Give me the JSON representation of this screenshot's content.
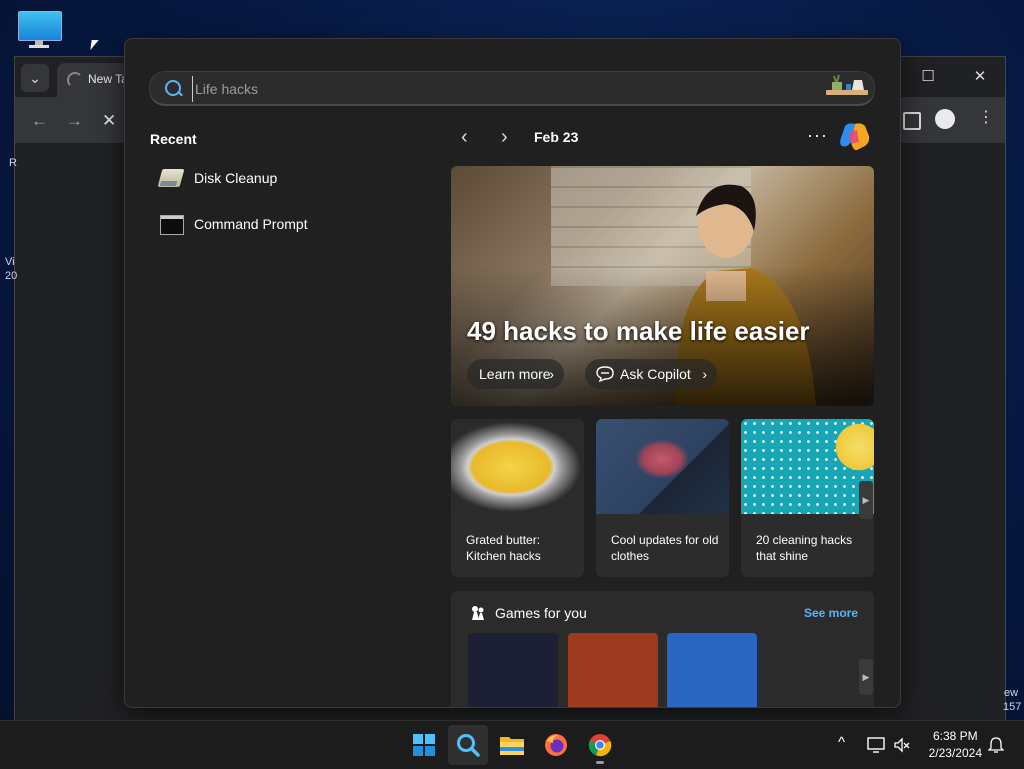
{
  "desktop": {
    "edge_text": [
      "R",
      "Vi",
      "20",
      "ew",
      "157"
    ]
  },
  "browser": {
    "tab_title": "New Ta",
    "window_controls": {
      "minimize": "—",
      "maximize": "☐",
      "close": "✕"
    },
    "nav": {
      "back": "←",
      "forward": "→",
      "stop": "✕"
    }
  },
  "search": {
    "query": "Life hacks",
    "placeholder": "Life hacks"
  },
  "recent": {
    "heading": "Recent",
    "items": [
      {
        "label": "Disk Cleanup",
        "icon": "disk-cleanup-icon"
      },
      {
        "label": "Command Prompt",
        "icon": "command-prompt-icon"
      }
    ]
  },
  "news": {
    "date": "Feb 23",
    "more_label": "···",
    "hero": {
      "headline": "49 hacks to make life easier",
      "learn_more": "Learn more",
      "ask_copilot": "Ask Copilot"
    },
    "cards": [
      {
        "title": "Grated butter: Kitchen hacks"
      },
      {
        "title": "Cool updates for old clothes"
      },
      {
        "title": "20 cleaning hacks that shine"
      }
    ]
  },
  "games": {
    "title": "Games for you",
    "see_more": "See more",
    "tile_colors": [
      "#1d2035",
      "#9b3a1f",
      "#2a65c2"
    ]
  },
  "taskbar": {
    "time": "6:38 PM",
    "date": "2/23/2024",
    "apps": [
      "start-icon",
      "search-icon",
      "file-explorer-icon",
      "firefox-icon",
      "chrome-icon"
    ]
  },
  "colors": {
    "accent": "#5bb4f5",
    "panel": "#202020"
  }
}
